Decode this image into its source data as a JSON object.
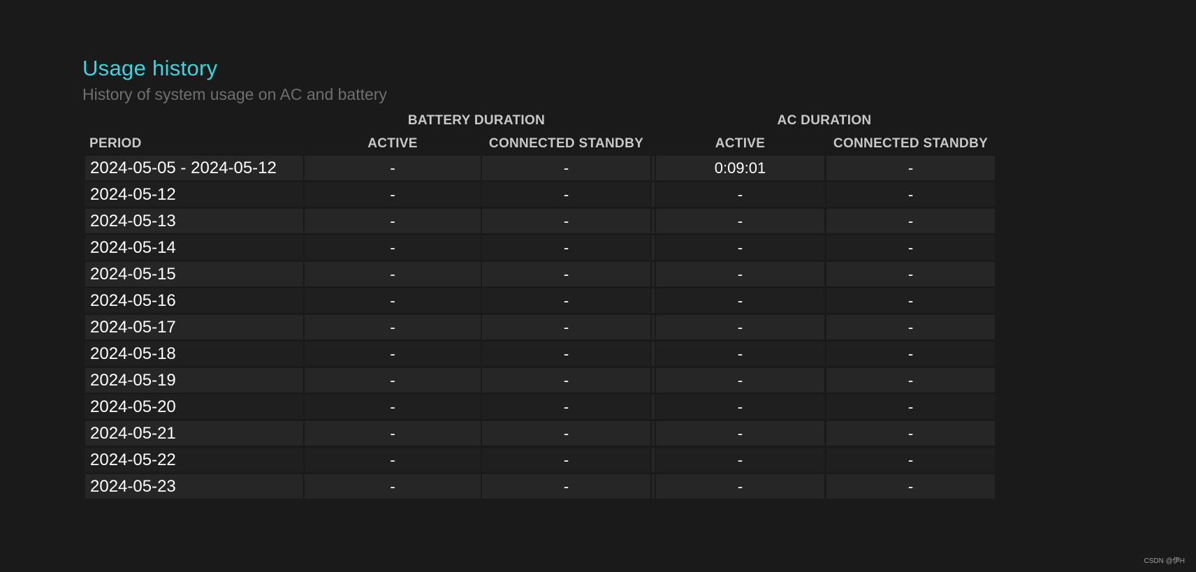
{
  "header": {
    "title": "Usage history",
    "subtitle": "History of system usage on AC and battery"
  },
  "table": {
    "groups": {
      "battery": "BATTERY DURATION",
      "ac": "AC DURATION"
    },
    "columns": {
      "period": "PERIOD",
      "battery_active": "ACTIVE",
      "battery_standby": "CONNECTED STANDBY",
      "ac_active": "ACTIVE",
      "ac_standby": "CONNECTED STANDBY"
    },
    "rows": [
      {
        "period": "2024-05-05 - 2024-05-12",
        "battery_active": "-",
        "battery_standby": "-",
        "ac_active": "0:09:01",
        "ac_standby": "-"
      },
      {
        "period": "2024-05-12",
        "battery_active": "-",
        "battery_standby": "-",
        "ac_active": "-",
        "ac_standby": "-"
      },
      {
        "period": "2024-05-13",
        "battery_active": "-",
        "battery_standby": "-",
        "ac_active": "-",
        "ac_standby": "-"
      },
      {
        "period": "2024-05-14",
        "battery_active": "-",
        "battery_standby": "-",
        "ac_active": "-",
        "ac_standby": "-"
      },
      {
        "period": "2024-05-15",
        "battery_active": "-",
        "battery_standby": "-",
        "ac_active": "-",
        "ac_standby": "-"
      },
      {
        "period": "2024-05-16",
        "battery_active": "-",
        "battery_standby": "-",
        "ac_active": "-",
        "ac_standby": "-"
      },
      {
        "period": "2024-05-17",
        "battery_active": "-",
        "battery_standby": "-",
        "ac_active": "-",
        "ac_standby": "-"
      },
      {
        "period": "2024-05-18",
        "battery_active": "-",
        "battery_standby": "-",
        "ac_active": "-",
        "ac_standby": "-"
      },
      {
        "period": "2024-05-19",
        "battery_active": "-",
        "battery_standby": "-",
        "ac_active": "-",
        "ac_standby": "-"
      },
      {
        "period": "2024-05-20",
        "battery_active": "-",
        "battery_standby": "-",
        "ac_active": "-",
        "ac_standby": "-"
      },
      {
        "period": "2024-05-21",
        "battery_active": "-",
        "battery_standby": "-",
        "ac_active": "-",
        "ac_standby": "-"
      },
      {
        "period": "2024-05-22",
        "battery_active": "-",
        "battery_standby": "-",
        "ac_active": "-",
        "ac_standby": "-"
      },
      {
        "period": "2024-05-23",
        "battery_active": "-",
        "battery_standby": "-",
        "ac_active": "-",
        "ac_standby": "-"
      }
    ]
  },
  "watermark": "CSDN @伊H",
  "colors": {
    "background": "#1a1a1a",
    "title": "#3fd3e0",
    "subtitle": "#6f6f6f",
    "header_text": "#c8c8c8",
    "row_odd": "#262626",
    "row_even": "#1f1f1f"
  }
}
